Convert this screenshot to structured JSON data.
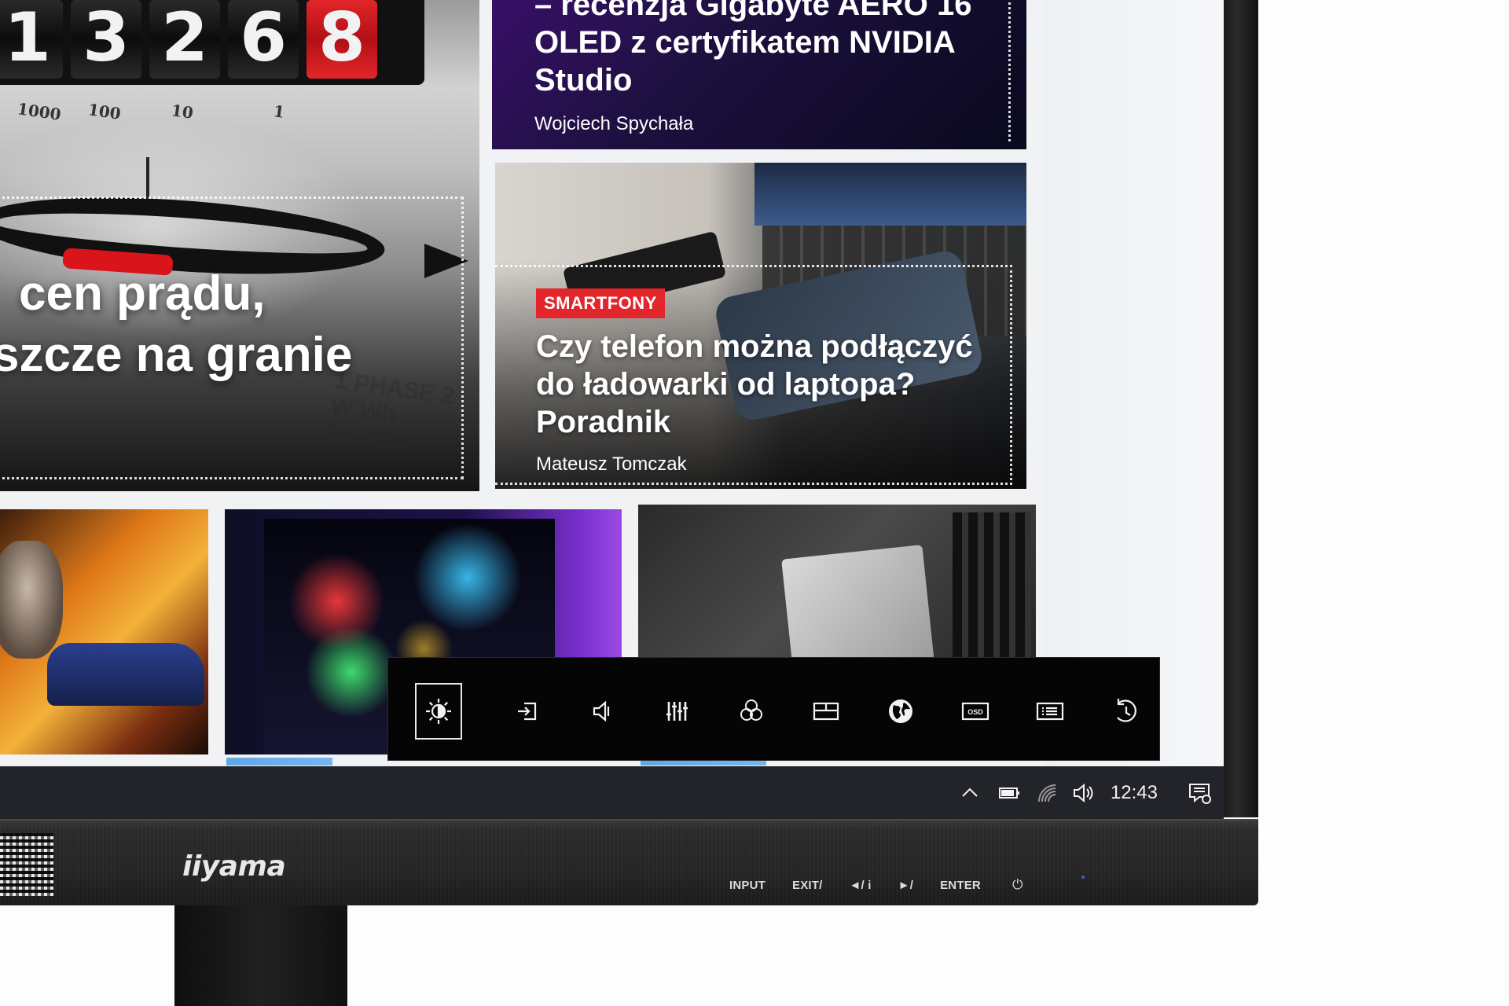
{
  "screen": {
    "hero": {
      "counter_digits": [
        "1",
        "3",
        "2",
        "6",
        "8"
      ],
      "scale_marks": [
        "1000",
        "100",
        "10",
        "1"
      ],
      "title_line1": "cen prądu,",
      "title_line2": "szcze na granie",
      "meter_print": "1 PHASE 2 W Wh METER"
    },
    "article_top": {
      "title": "– recenzja Gigabyte AERO 16 OLED z certyfikatem NVIDIA Studio",
      "author": "Wojciech Spychała"
    },
    "article_mid": {
      "category": "SMARTFONY",
      "title": "Czy telefon można podłączyć do ładowarki od laptopa? Poradnik",
      "author": "Mateusz Tomczak"
    },
    "osd_menu": {
      "items": [
        {
          "icon": "brightness-icon",
          "active": true
        },
        {
          "icon": "input-icon",
          "active": false
        },
        {
          "icon": "volume-icon",
          "active": false
        },
        {
          "icon": "equalizer-icon",
          "active": false
        },
        {
          "icon": "color-rgb-icon",
          "active": false
        },
        {
          "icon": "picture-adjust-icon",
          "active": false
        },
        {
          "icon": "language-globe-icon",
          "active": false
        },
        {
          "icon": "osd-icon",
          "active": false
        },
        {
          "icon": "information-icon",
          "active": false
        },
        {
          "icon": "reset-icon",
          "active": false
        }
      ],
      "osd_label": "OSD"
    },
    "taskbar": {
      "tray_icons": [
        "chevron-up-icon",
        "battery-icon",
        "wifi-icon",
        "speaker-icon",
        "notification-icon"
      ],
      "clock": "12:43"
    }
  },
  "monitor": {
    "brand": "iiyama",
    "buttons": {
      "input": "INPUT",
      "exit": "EXIT/",
      "left": "◄/ i",
      "right": "►/",
      "enter": "ENTER",
      "power": "⏻"
    }
  },
  "colors": {
    "osd_background": "#050505",
    "badge_red": "#e2262b",
    "taskbar": "#222429",
    "bezel": "#262626"
  }
}
